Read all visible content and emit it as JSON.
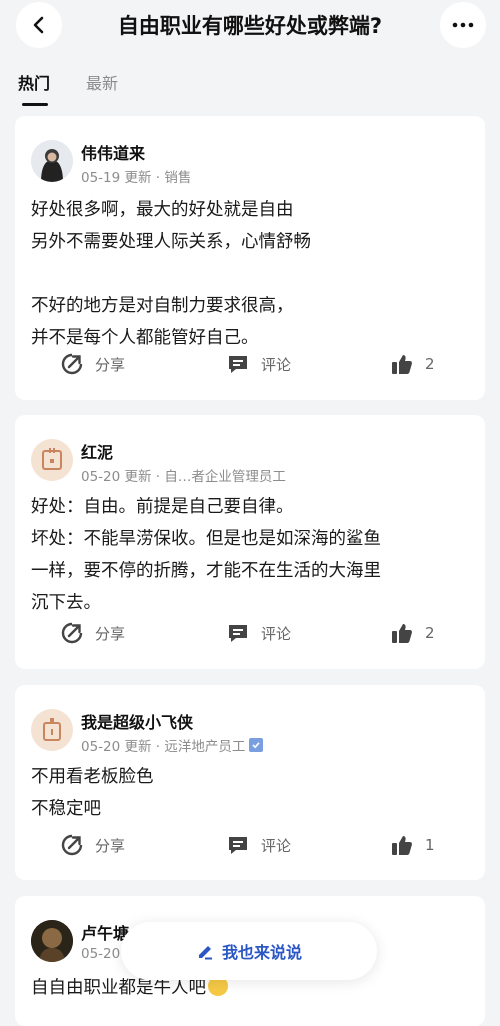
{
  "header": {
    "title": "自由职业有哪些好处或弊端?"
  },
  "tabs": [
    {
      "label": "热门",
      "active": true
    },
    {
      "label": "最新",
      "active": false
    }
  ],
  "posts": [
    {
      "author": "伟伟道来",
      "meta": "05-19 更新 · 销售",
      "lines": [
        "好处很多啊，最大的好处就是自由",
        "另外不需要处理人际关系，心情舒畅",
        "",
        "不好的地方是对自制力要求很高，",
        "并不是每个人都能管好自己。"
      ],
      "share_label": "分享",
      "comment_label": "评论",
      "likes": "2"
    },
    {
      "author": "红泥",
      "meta": "05-20 更新 · 自…者企业管理员工",
      "lines": [
        "好处：自由。前提是自己要自律。",
        "坏处：不能旱涝保收。但是也是如深海的鲨鱼",
        "一样，要不停的折腾，才能不在生活的大海里",
        "沉下去。"
      ],
      "share_label": "分享",
      "comment_label": "评论",
      "likes": "2"
    },
    {
      "author": "我是超级小飞侠",
      "meta": "05-20 更新 · 远洋地产员工",
      "lines": [
        "不用看老板脸色",
        "不稳定吧"
      ],
      "share_label": "分享",
      "comment_label": "评论",
      "likes": "1"
    },
    {
      "author": "卢午塘",
      "meta": "05-20",
      "lines": [
        "自自由职业都是牛人吧"
      ],
      "share_label": "",
      "comment_label": "",
      "likes": ""
    }
  ],
  "floating_button": {
    "label": "我也来说说"
  },
  "colors": {
    "accent": "#2a56c6",
    "background": "#f3f4f6",
    "card": "#ffffff"
  },
  "icons": [
    "back-arrow-icon",
    "more-dots-icon",
    "share-icon",
    "comment-icon",
    "thumbs-up-icon",
    "pen-icon",
    "verified-icon"
  ]
}
